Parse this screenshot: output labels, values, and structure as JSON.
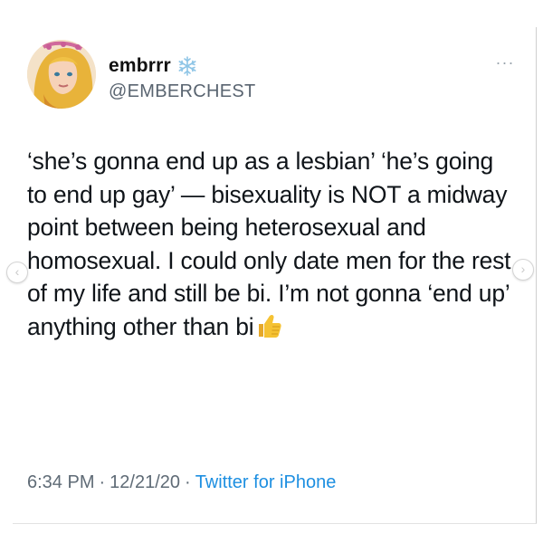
{
  "author": {
    "display_name": "embrrr",
    "handle": "@EMBERCHEST",
    "badge_icon": "snowflake-icon",
    "avatar_icon": "cartoon-avatar-icon"
  },
  "tweet": {
    "text": "‘she’s gonna end up as a lesbian’ ‘he’s going to end up gay’ — bisexuality is NOT a midway point between being heterosexual and homosexual. I could only date men for the rest of my life and still be bi. I’m not gonna ‘end up’ anything other than bi",
    "trailing_emoji": "thumbs-up-icon"
  },
  "meta": {
    "time": "6:34 PM",
    "separator": "·",
    "date": "12/21/20",
    "source": "Twitter for iPhone"
  },
  "controls": {
    "more_glyph": "···",
    "prev_glyph": "‹",
    "next_glyph": "›"
  },
  "colors": {
    "text": "#0f1419",
    "secondary": "#5f6b76",
    "link": "#1d8fe1",
    "badge": "#8ec5e6"
  }
}
